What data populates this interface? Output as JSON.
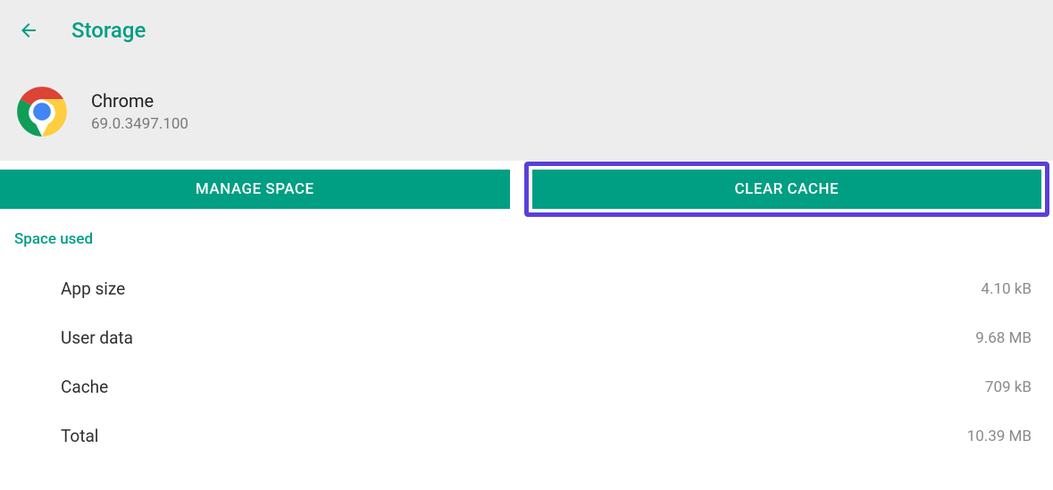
{
  "header": {
    "title": "Storage"
  },
  "app": {
    "name": "Chrome",
    "version": "69.0.3497.100"
  },
  "buttons": {
    "manage_space": "MANAGE SPACE",
    "clear_cache": "CLEAR CACHE"
  },
  "section": {
    "label": "Space used",
    "rows": [
      {
        "label": "App size",
        "value": "4.10 kB"
      },
      {
        "label": "User data",
        "value": "9.68 MB"
      },
      {
        "label": "Cache",
        "value": "709 kB"
      },
      {
        "label": "Total",
        "value": "10.39 MB"
      }
    ]
  }
}
